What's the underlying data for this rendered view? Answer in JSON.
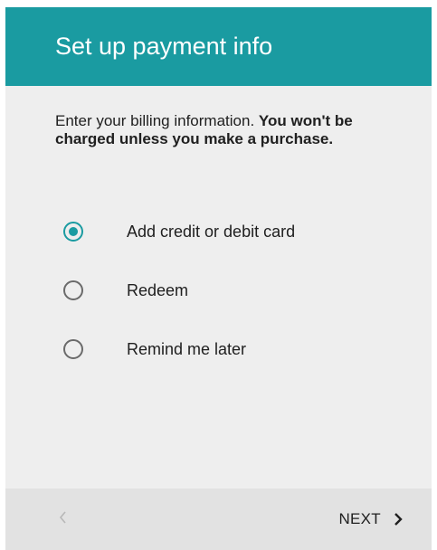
{
  "header": {
    "title": "Set up payment info"
  },
  "intro": {
    "text": "Enter your billing information.",
    "bold_text": "You won't be charged unless you make a purchase."
  },
  "options": [
    {
      "label": "Add credit or debit card",
      "selected": true
    },
    {
      "label": "Redeem",
      "selected": false
    },
    {
      "label": "Remind me later",
      "selected": false
    }
  ],
  "footer": {
    "back_icon": "chevron-left-icon",
    "next_label": "NEXT",
    "next_icon": "chevron-right-icon"
  },
  "colors": {
    "accent": "#1a9ba1",
    "background": "#eeeeee",
    "footer_background": "#e2e2e2"
  }
}
